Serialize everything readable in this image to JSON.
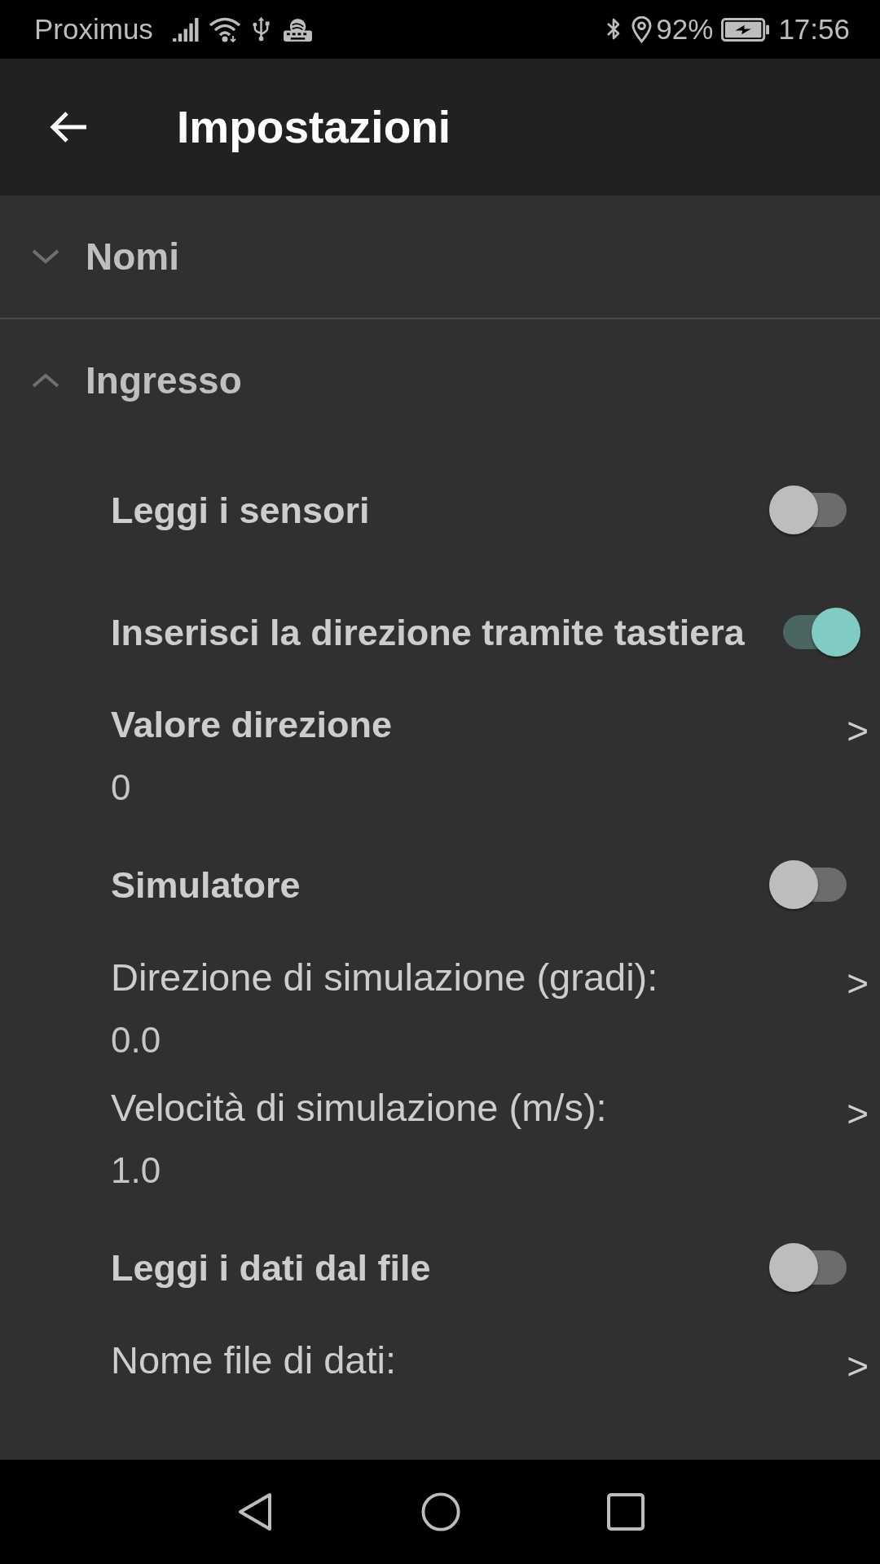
{
  "status_bar": {
    "carrier": "Proximus",
    "battery": "92%",
    "time": "17:56"
  },
  "app_bar": {
    "title": "Impostazioni"
  },
  "sections": [
    {
      "title": "Nomi",
      "expanded": false
    },
    {
      "title": "Ingresso",
      "expanded": true,
      "items": [
        {
          "kind": "switch",
          "label": "Leggi i sensori",
          "on": false
        },
        {
          "kind": "switch",
          "label": "Inserisci la direzione tramite tastiera",
          "on": true
        },
        {
          "kind": "preference",
          "label": "Valore direzione",
          "value": "0",
          "indicator": ">"
        },
        {
          "kind": "switch",
          "label": "Simulatore",
          "on": false
        },
        {
          "kind": "input",
          "label": "Direzione di simulazione (gradi):",
          "value": "0.0",
          "indicator": ">"
        },
        {
          "kind": "input",
          "label": "Velocità di simulazione (m/s):",
          "value": "1.0",
          "indicator": ">"
        },
        {
          "kind": "switch",
          "label": "Leggi i dati dal file",
          "on": false
        },
        {
          "kind": "input",
          "label": "Nome file di dati:",
          "indicator": ">"
        }
      ]
    }
  ]
}
